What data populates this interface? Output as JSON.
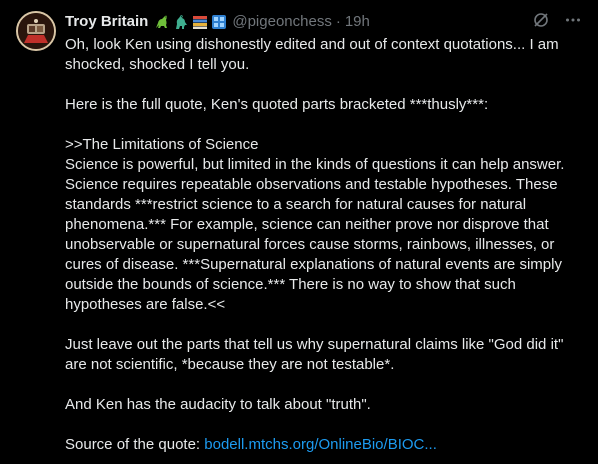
{
  "author": {
    "display_name": "Troy Britain",
    "handle": "@pigeonchess",
    "separator": "·",
    "time": "19h"
  },
  "icons": {
    "badges": [
      "dinosaur-green-icon",
      "dinosaur-teal-icon",
      "books-icon",
      "blue-grid-icon"
    ],
    "actions": [
      "grok-icon",
      "more-icon"
    ]
  },
  "body": {
    "para1": "Oh, look Ken using dishonestly edited and out of context quotations... I am shocked, shocked I tell you.",
    "para2": "Here is the full quote, Ken's quoted parts bracketed ***thusly***:",
    "para3_heading": ">>The Limitations of Science",
    "para3_text": "Science is powerful, but limited in the kinds of questions it can help answer. Science requires repeatable observations and testable hypotheses. These standards ***restrict science to a search for natural causes for natural phenomena.*** For example, science can neither prove nor disprove that unobservable or supernatural forces cause storms, rainbows, illnesses, or cures of disease. ***Supernatural explanations of natural events are simply outside the bounds of science.*** There is no way to show that such hypotheses are false.<<",
    "para4": "Just leave out the parts that tell us why supernatural claims like \"God did it\" are not scientific, *because they are not testable*.",
    "para5": "And Ken has the audacity to talk about \"truth\".",
    "source_label": "Source of the quote: ",
    "source_link": "bodell.mtchs.org/OnlineBio/BIOC..."
  },
  "colors": {
    "background": "#000000",
    "text": "#e7e9ea",
    "muted": "#71767b",
    "link": "#1d9bf0"
  }
}
